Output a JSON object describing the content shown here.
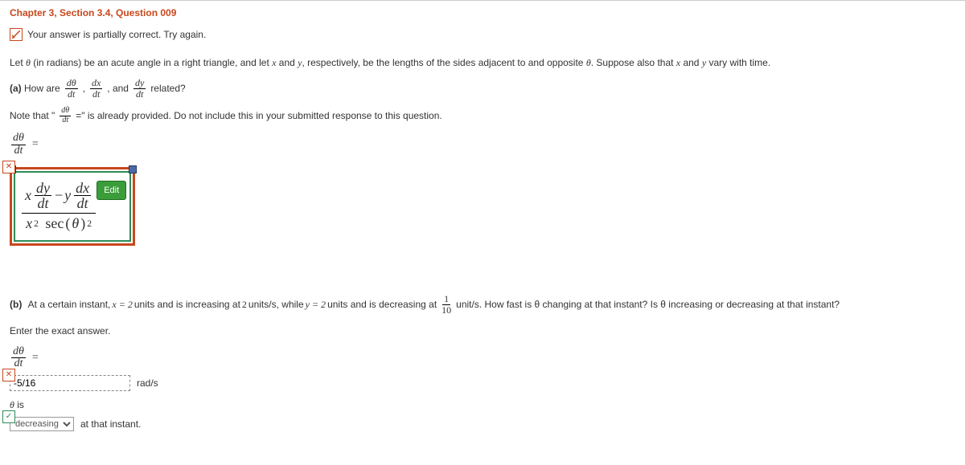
{
  "header": {
    "title": "Chapter 3, Section 3.4, Question 009"
  },
  "feedback": {
    "text": "Your answer is partially correct.  Try again."
  },
  "intro": "Let θ (in radians) be an acute angle in a right triangle, and let x and y, respectively, be the lengths of the sides adjacent to and opposite θ. Suppose also that x and y vary with time.",
  "partA": {
    "label": "(a)",
    "lead": "How are",
    "and": ", and",
    "tail": "related?",
    "derivs": {
      "d1n": "dθ",
      "d1d": "dt",
      "d2n": "dx",
      "d2d": "dt",
      "d3n": "dy",
      "d3d": "dt"
    },
    "note_pre": "Note that \"",
    "note_eq": "=\" is already provided. Do not include this in your submitted response to this question.",
    "lhs_n": "dθ",
    "lhs_d": "dt",
    "eq": "=",
    "answer_expr": {
      "top_terms": {
        "x": "x",
        "dy": "dy",
        "dt": "dt",
        "minus": "−",
        "y": "y",
        "dx": "dx"
      },
      "bot": {
        "x": "x",
        "sup": "2",
        "sec": "sec",
        "lp": "(",
        "th": "θ",
        "rp": ")",
        "sup2": "2"
      }
    },
    "edit_label": "Edit"
  },
  "partB": {
    "label": "(b)",
    "t1": "At a certain instant, ",
    "xeq": "x = 2",
    "t2": " units and is increasing at ",
    "rate1": "2",
    "t3": " units/s, while ",
    "yeq": "y = 2",
    "t4": " units and is decreasing at ",
    "frac_n": "1",
    "frac_d": "10",
    "t5": " unit/s. How fast is θ changing at that instant? Is θ increasing or decreasing at that instant?",
    "enter": "Enter the exact answer.",
    "lhs_n": "dθ",
    "lhs_d": "dt",
    "eq": "=",
    "input_value": "-5/16",
    "units": "rad/s",
    "theta_is": "θ is",
    "select_value": "decreasing",
    "tail": "at that instant."
  }
}
